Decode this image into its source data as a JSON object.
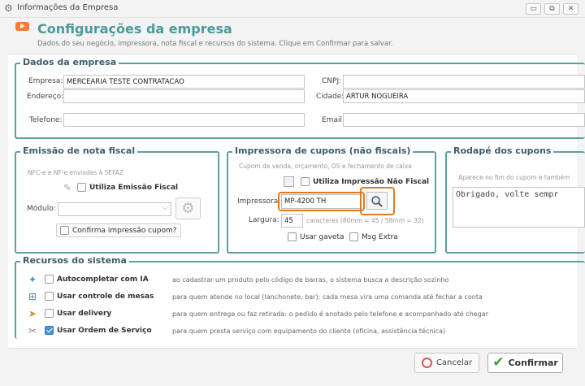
{
  "window": {
    "title": "Informações da Empresa",
    "minimize": "▭",
    "restore": "⧉",
    "close": "✕"
  },
  "header": {
    "title": "Configurações da empresa",
    "subtitle": "Dados do seu negócio, impressora, nota fiscal e recursos do sistema. Clique em Confirmar para salvar."
  },
  "empresa": {
    "legend": "Dados da empresa",
    "empresa_label": "Empresa:",
    "empresa_value": "MERCEARIA TESTE CONTRATACAO",
    "endereco_label": "Endereço:",
    "endereco_value": "",
    "telefone_label": "Telefone:",
    "telefone_value": "",
    "cnpj_label": "CNPJ:",
    "cnpj_value": "",
    "cidade_label": "Cidade:",
    "cidade_value": "ARTUR NOGUEIRA",
    "email_label": "Email:",
    "email_value": ""
  },
  "nota": {
    "legend": "Emissão de nota fiscal",
    "hint": "NFC-e e NF-e enviadas à SEFAZ",
    "utiliza_label": "Utiliza Emissão Fiscal",
    "modulo_label": "Módulo:",
    "modulo_value": "",
    "confirma_label": "Confirma impressão cupom?"
  },
  "impressora": {
    "legend": "Impressora de cupons (não fiscais)",
    "hint": "Cupom de venda, orçamento, OS e fechamento de caixa",
    "utiliza_label": "Utiliza Impressão Não Fiscal",
    "impressora_label": "Impressora:",
    "impressora_value": "MP-4200 TH",
    "largura_label": "Largura:",
    "largura_value": "45",
    "largura_hint": "caracteres (80mm = 45 / 58mm = 32)",
    "gaveta_label": "Usar gaveta",
    "msg_label": "Msg Extra"
  },
  "rodape": {
    "legend": "Rodapé dos cupons",
    "hint": "Aparece no fim do cupom e também",
    "value": "Obrigado, volte sempr"
  },
  "recursos": {
    "legend": "Recursos do sistema",
    "items": [
      {
        "label": "Autocompletar com IA",
        "desc": "ao cadastrar um produto pelo código de barras, o sistema busca a descrição sozinho",
        "checked": false
      },
      {
        "label": "Usar controle de mesas",
        "desc": "para quem atende no local (lanchonete, bar): cada mesa vira uma comanda até fechar a conta",
        "checked": false
      },
      {
        "label": "Usar delivery",
        "desc": "para quem entrega ou faz retirada: o pedido é anotado pelo telefone e acompanhado até chegar",
        "checked": false
      },
      {
        "label": "Usar Ordem de Serviço",
        "desc": "para quem presta serviço com equipamento do cliente (oficina, assistência técnica)",
        "checked": true
      }
    ]
  },
  "footer": {
    "cancel_label": "Cancelar",
    "confirm_label": "Confirmar"
  },
  "colors": {
    "accent": "#5e9f9f",
    "highlight": "#e07a20",
    "title": "#4a9a9a"
  }
}
